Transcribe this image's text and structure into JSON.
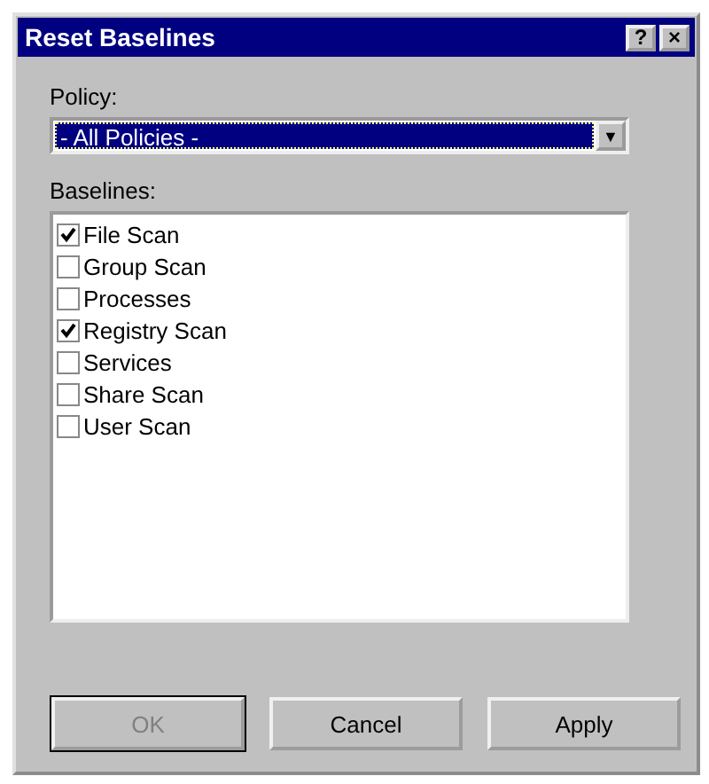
{
  "window": {
    "title": "Reset Baselines",
    "help_button": "?",
    "close_button": "×"
  },
  "policy": {
    "label": "Policy:",
    "value": "- All Policies -",
    "arrow": "▼"
  },
  "baselines": {
    "label": "Baselines:",
    "items": [
      {
        "label": "File Scan",
        "checked": true
      },
      {
        "label": "Group Scan",
        "checked": false
      },
      {
        "label": "Processes",
        "checked": false
      },
      {
        "label": "Registry Scan",
        "checked": true
      },
      {
        "label": "Services",
        "checked": false
      },
      {
        "label": "Share Scan",
        "checked": false
      },
      {
        "label": "User Scan",
        "checked": false
      }
    ]
  },
  "buttons": [
    {
      "label": "OK",
      "disabled": true,
      "default": true
    },
    {
      "label": "Cancel",
      "disabled": false,
      "default": false
    },
    {
      "label": "Apply",
      "disabled": false,
      "default": false
    }
  ]
}
